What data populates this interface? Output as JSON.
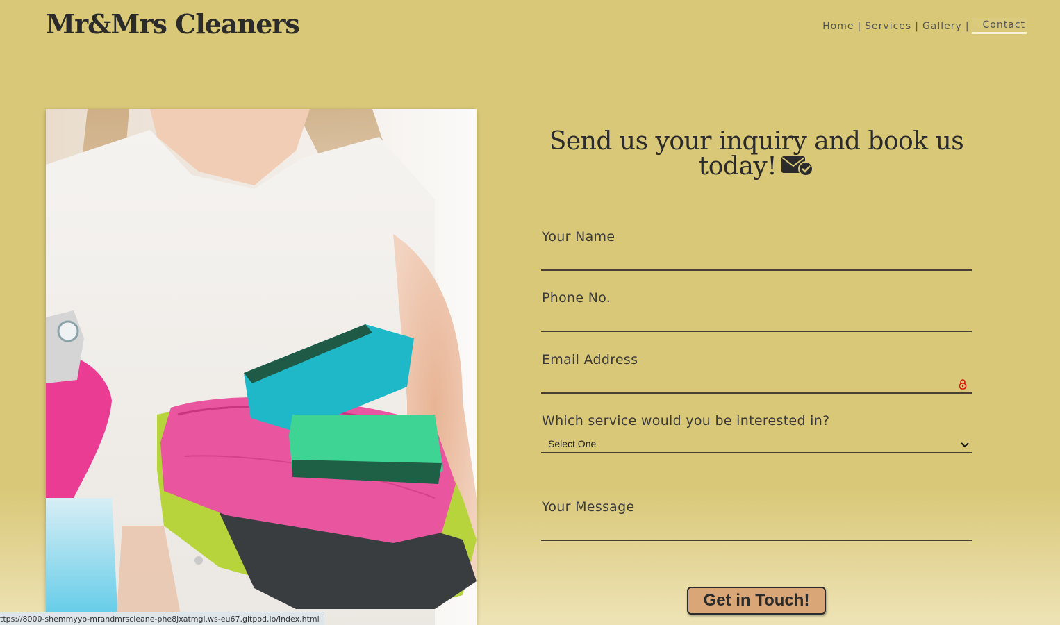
{
  "header": {
    "brand": "Mr&Mrs Cleaners",
    "nav": [
      {
        "label": "Home"
      },
      {
        "label": "Services"
      },
      {
        "label": "Gallery"
      },
      {
        "label": "Contact",
        "active": true
      }
    ],
    "separator": "|"
  },
  "hero": {
    "image_icon": "cleaning-supplies-photo"
  },
  "form": {
    "heading": "Send us your inquiry and book us today!",
    "heading_icon": "mail-check-icon",
    "fields": {
      "name": {
        "label": "Your Name",
        "value": ""
      },
      "phone": {
        "label": "Phone No.",
        "value": ""
      },
      "email": {
        "label": "Email Address",
        "value": "",
        "icon": "password-key-icon"
      },
      "service": {
        "label": "Which service would you be interested in?",
        "selected": "Select One"
      },
      "message": {
        "label": "Your Message",
        "value": ""
      }
    },
    "submit_label": "Get in Touch!"
  },
  "status_bar": {
    "url": "ttps://8000-shemmyyo-mrandmrscleane-phe8jxatmgi.ws-eu67.gitpod.io/index.html"
  },
  "colors": {
    "background": "#d9c878",
    "text": "#2b2b2b",
    "button": "#d9a677",
    "underline": "#4a3f35",
    "active_nav_underline": "#f7f1d6"
  }
}
